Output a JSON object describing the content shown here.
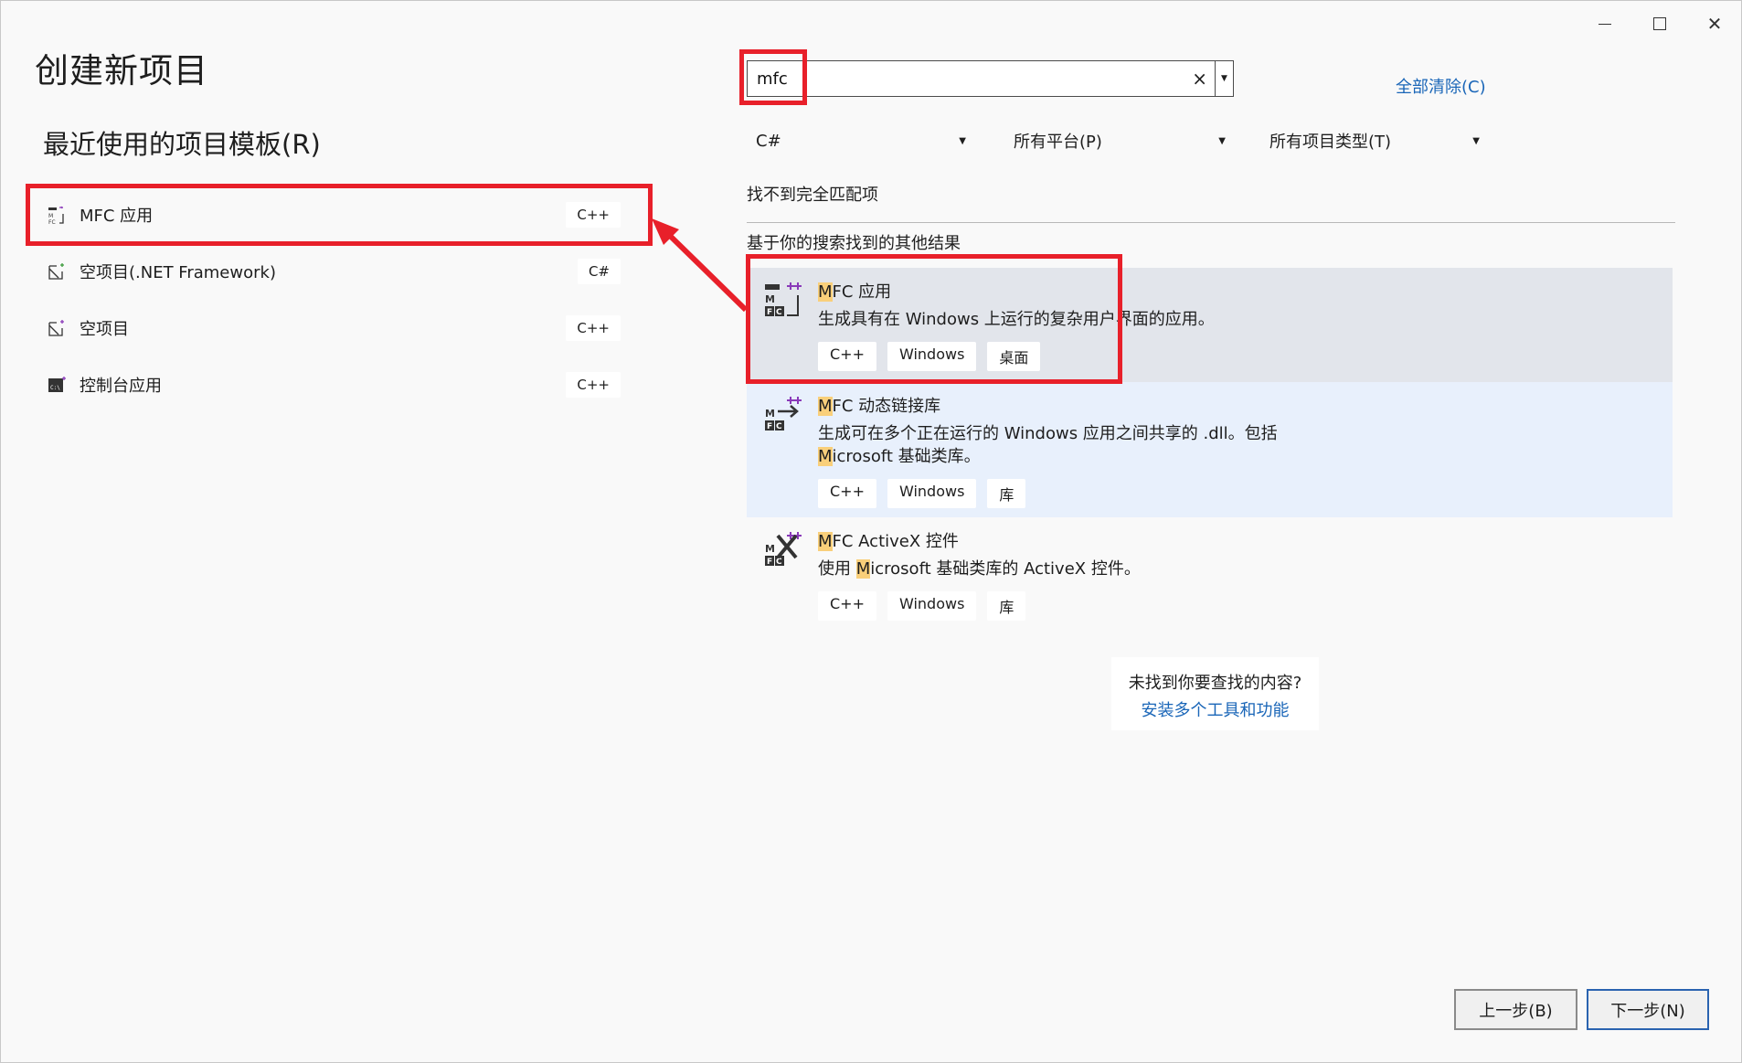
{
  "page": {
    "title": "创建新项目"
  },
  "recent": {
    "title": "最近使用的项目模板(R)",
    "items": [
      {
        "label": "MFC 应用",
        "lang": "C++"
      },
      {
        "label": "空项目(.NET Framework)",
        "lang": "C#"
      },
      {
        "label": "空项目",
        "lang": "C++"
      },
      {
        "label": "控制台应用",
        "lang": "C++"
      }
    ]
  },
  "search": {
    "value": "mfc",
    "clear_icon": "×",
    "clear_all": "全部清除(C)"
  },
  "filters": {
    "language": "C#",
    "platform": "所有平台(P)",
    "project_type": "所有项目类型(T)"
  },
  "messages": {
    "no_match": "找不到完全匹配项",
    "other_results": "基于你的搜索找到的其他结果"
  },
  "results": [
    {
      "title_hi": "M",
      "title_rest": "FC 应用",
      "desc": "生成具有在 Windows 上运行的复杂用户界面的应用。",
      "tags": [
        "C++",
        "Windows",
        "桌面"
      ]
    },
    {
      "title_hi": "M",
      "title_rest": "FC 动态链接库",
      "desc_line1": "生成可在多个正在运行的 Windows 应用之间共享的 .dll。包括",
      "desc_line2_hi": "M",
      "desc_line2_rest": "icrosoft 基础类库。",
      "tags": [
        "C++",
        "Windows",
        "库"
      ]
    },
    {
      "title_hi": "M",
      "title_rest": "FC ActiveX 控件",
      "desc_pre": "使用 ",
      "desc_hi": "M",
      "desc_rest": "icrosoft 基础类库的 ActiveX 控件。",
      "tags": [
        "C++",
        "Windows",
        "库"
      ]
    }
  ],
  "help": {
    "question": "未找到你要查找的内容?",
    "link": "安装多个工具和功能"
  },
  "buttons": {
    "prev": "上一步(B)",
    "next": "下一步(N)"
  },
  "colors": {
    "highlight_red": "#e8202a",
    "link_blue": "#1a66b8",
    "match_highlight": "#f9cf7a"
  }
}
